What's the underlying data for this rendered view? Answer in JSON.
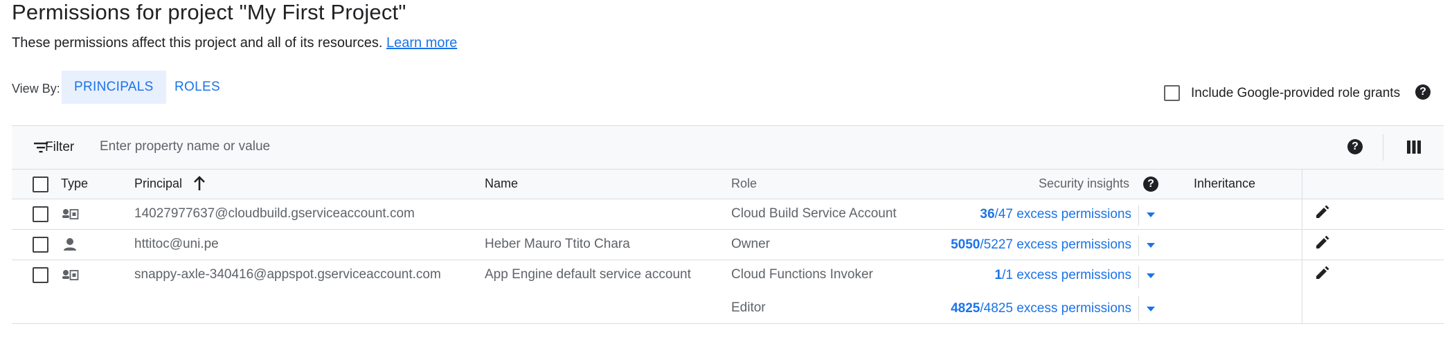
{
  "header": {
    "title": "Permissions for project \"My First Project\"",
    "description": "These permissions affect this project and all of its resources.",
    "learn_more": "Learn more"
  },
  "view_by": {
    "label": "View By:",
    "tabs": [
      {
        "label": "PRINCIPALS",
        "active": true
      },
      {
        "label": "ROLES",
        "active": false
      }
    ]
  },
  "include_google_grants": {
    "label": "Include Google-provided role grants",
    "checked": false
  },
  "filter": {
    "label": "Filter",
    "placeholder": "Enter property name or value"
  },
  "table": {
    "columns": {
      "type": "Type",
      "principal": "Principal",
      "name": "Name",
      "role": "Role",
      "security_insights": "Security insights",
      "inheritance": "Inheritance"
    },
    "rows": [
      {
        "type_icon": "service-account-icon",
        "principal": "14027977637@cloudbuild.gserviceaccount.com",
        "name": "",
        "role": "Cloud Build Service Account",
        "insight_num": "36",
        "insight_rest": "/47 excess permissions"
      },
      {
        "type_icon": "person-icon",
        "principal": "httitoc@uni.pe",
        "name": "Heber Mauro Ttito Chara",
        "role": "Owner",
        "insight_num": "5050",
        "insight_rest": "/5227 excess permissions"
      },
      {
        "type_icon": "service-account-icon",
        "principal": "snappy-axle-340416@appspot.gserviceaccount.com",
        "name": "App Engine default service account",
        "role": "Cloud Functions Invoker",
        "insight_num": "1",
        "insight_rest": "/1 excess permissions"
      },
      {
        "type_icon": "",
        "principal": "",
        "name": "",
        "role": "Editor",
        "insight_num": "4825",
        "insight_rest": "/4825 excess permissions"
      }
    ]
  },
  "colors": {
    "accent": "#1a73e8",
    "tab_active_bg": "#e8f0fe",
    "divider": "#dadce0"
  }
}
